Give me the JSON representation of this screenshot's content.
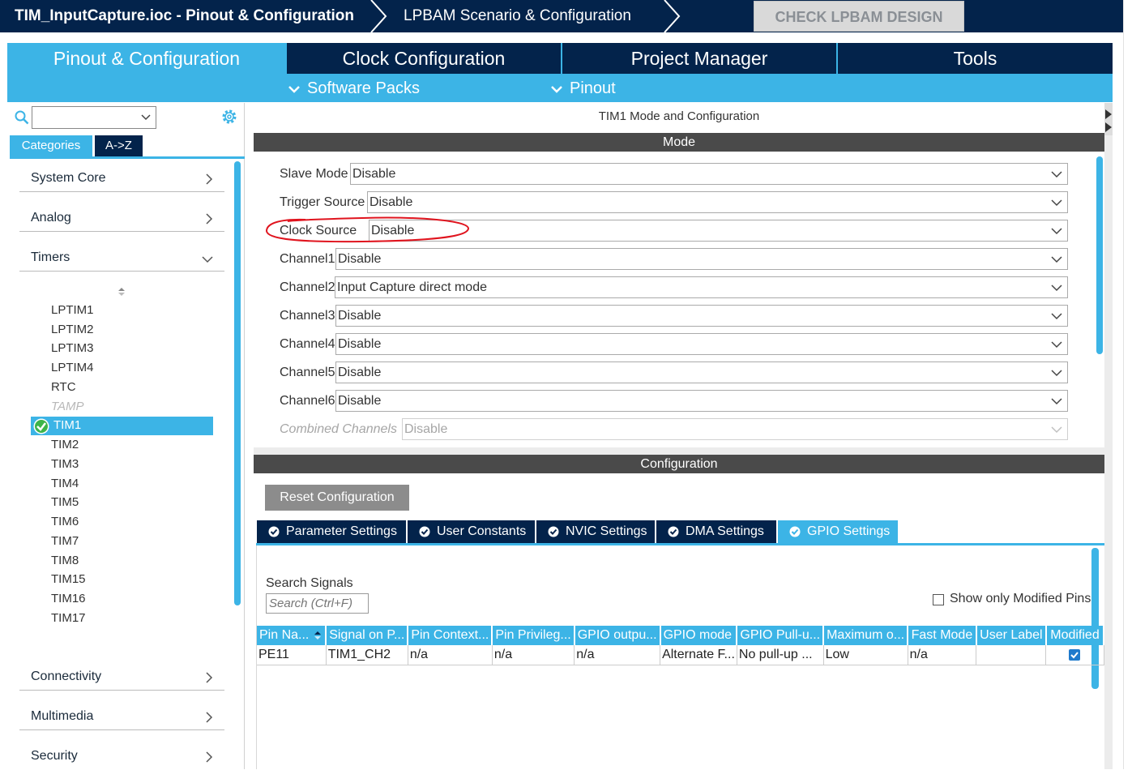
{
  "breadcrumb": {
    "project": "TIM_InputCapture.ioc - Pinout & Configuration",
    "scenario": "LPBAM Scenario & Configuration",
    "check_button": "CHECK LPBAM DESIGN"
  },
  "main_tabs": {
    "pinout": "Pinout & Configuration",
    "clock": "Clock Configuration",
    "project": "Project Manager",
    "tools": "Tools"
  },
  "sub_tabs": {
    "software_packs": "Software Packs",
    "pinout": "Pinout"
  },
  "left_panel": {
    "search_value": "",
    "tab_categories": "Categories",
    "tab_az": "A->Z",
    "categories": {
      "system_core": "System Core",
      "analog": "Analog",
      "timers": "Timers",
      "connectivity": "Connectivity",
      "multimedia": "Multimedia",
      "security": "Security"
    },
    "timers": [
      "LPTIM1",
      "LPTIM2",
      "LPTIM3",
      "LPTIM4",
      "RTC",
      "TAMP",
      "TIM1",
      "TIM2",
      "TIM3",
      "TIM4",
      "TIM5",
      "TIM6",
      "TIM7",
      "TIM8",
      "TIM15",
      "TIM16",
      "TIM17"
    ],
    "selected_timer": "TIM1"
  },
  "mode": {
    "title": "TIM1 Mode and Configuration",
    "header": "Mode",
    "rows": [
      {
        "label": "Slave Mode",
        "value": "Disable"
      },
      {
        "label": "Trigger Source",
        "value": "Disable"
      },
      {
        "label": "Clock Source",
        "value": "Disable"
      },
      {
        "label": "Channel1",
        "value": "Disable"
      },
      {
        "label": "Channel2",
        "value": "Input Capture direct mode"
      },
      {
        "label": "Channel3",
        "value": "Disable"
      },
      {
        "label": "Channel4",
        "value": "Disable"
      },
      {
        "label": "Channel5",
        "value": "Disable"
      },
      {
        "label": "Channel6",
        "value": "Disable"
      },
      {
        "label": "Combined Channels",
        "value": "Disable"
      }
    ]
  },
  "configuration": {
    "header": "Configuration",
    "reset_button": "Reset Configuration",
    "tabs": [
      "Parameter Settings",
      "User Constants",
      "NVIC Settings",
      "DMA Settings",
      "GPIO Settings"
    ],
    "active_tab": "GPIO Settings",
    "search_label": "Search Signals",
    "search_placeholder": "Search (Ctrl+F)",
    "show_modified_label": "Show only Modified Pins",
    "table": {
      "headers": [
        "Pin Na...",
        "Signal on P...",
        "Pin Context...",
        "Pin Privileg...",
        "GPIO outpu...",
        "GPIO mode",
        "GPIO Pull-u...",
        "Maximum o...",
        "Fast Mode",
        "User Label",
        "Modified"
      ],
      "rows": [
        [
          "PE11",
          "TIM1_CH2",
          "n/a",
          "n/a",
          "n/a",
          "Alternate F...",
          "No pull-up ...",
          "Low",
          "n/a",
          "",
          ""
        ]
      ]
    }
  },
  "colors": {
    "navy": "#03234b",
    "accent": "#3cb4e6",
    "section_header": "#4a4a4a",
    "annotation": "#e0141e"
  }
}
